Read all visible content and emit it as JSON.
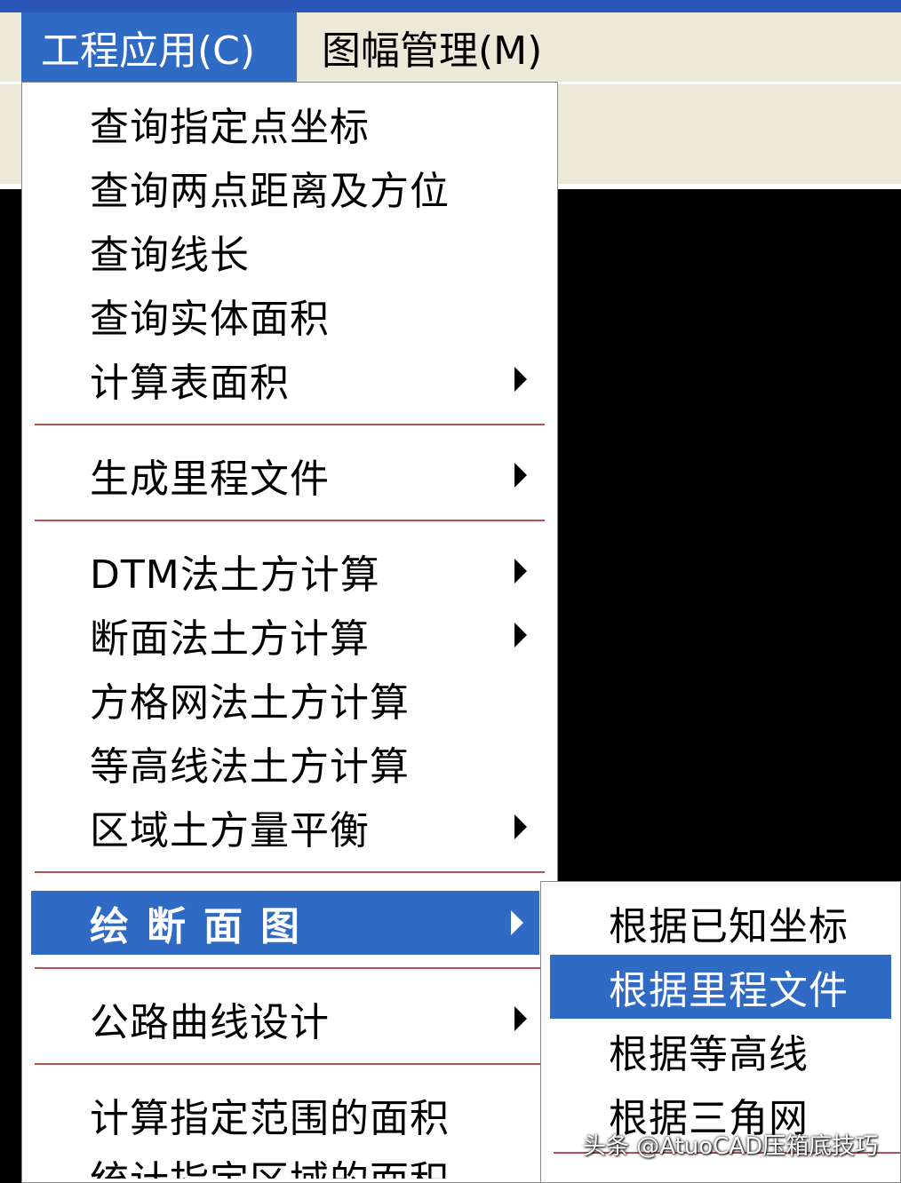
{
  "menubar": {
    "items": [
      {
        "label": "工程应用(C)",
        "active": true
      },
      {
        "label": "图幅管理(M)",
        "active": false
      }
    ]
  },
  "menu": {
    "items": [
      {
        "label": "查询指定点坐标",
        "submenu": false
      },
      {
        "label": "查询两点距离及方位",
        "submenu": false
      },
      {
        "label": "查询线长",
        "submenu": false
      },
      {
        "label": "查询实体面积",
        "submenu": false
      },
      {
        "label": "计算表面积",
        "submenu": true
      },
      {
        "label": "生成里程文件",
        "submenu": true
      },
      {
        "label": "DTM法土方计算",
        "submenu": true
      },
      {
        "label": "断面法土方计算",
        "submenu": true
      },
      {
        "label": "方格网法土方计算",
        "submenu": false
      },
      {
        "label": "等高线法土方计算",
        "submenu": false
      },
      {
        "label": "区域土方量平衡",
        "submenu": true
      },
      {
        "label": "绘断面图",
        "submenu": true,
        "highlighted": true
      },
      {
        "label": "公路曲线设计",
        "submenu": true
      },
      {
        "label": "计算指定范围的面积",
        "submenu": false
      },
      {
        "label": "统计指定区域的面积",
        "submenu": false
      }
    ]
  },
  "submenu": {
    "items": [
      {
        "label": "根据已知坐标"
      },
      {
        "label": "根据里程文件",
        "highlighted": true
      },
      {
        "label": "根据等高线"
      },
      {
        "label": "根据三角网"
      }
    ]
  },
  "watermark": "头条 @AtuoCAD压箱底技巧",
  "colors": {
    "highlight": "#2f6ac4",
    "separator": "#b55050",
    "menubar": "#ece9d8"
  }
}
